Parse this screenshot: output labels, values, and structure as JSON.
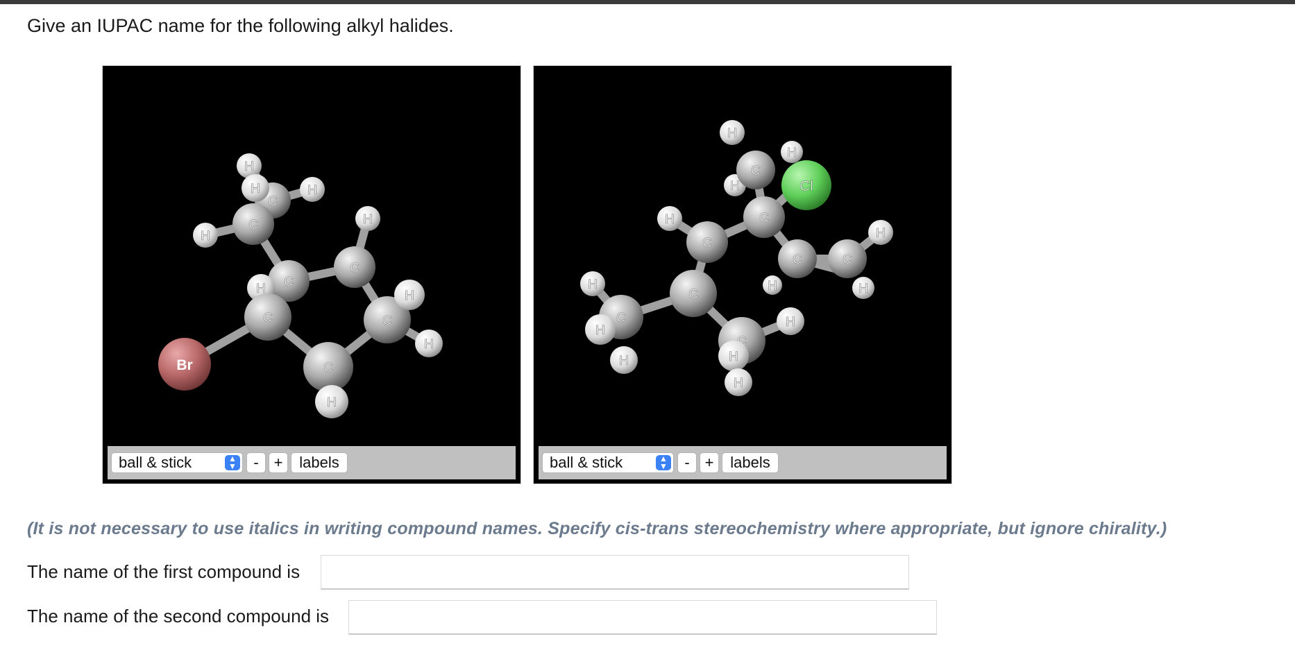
{
  "prompt": "Give an IUPAC name for the following alkyl halides.",
  "viewers": [
    {
      "style_select": "ball & stick",
      "minus_label": "-",
      "plus_label": "+",
      "labels_button": "labels",
      "atom_labels": {
        "carbon": "C",
        "hydrogen": "H",
        "halogen": "Br"
      },
      "colors": {
        "halogen": "#c77676",
        "carbon": "#a8a8a8",
        "hydrogen": "#e6e6e6"
      }
    },
    {
      "style_select": "ball & stick",
      "minus_label": "-",
      "plus_label": "+",
      "labels_button": "labels",
      "atom_labels": {
        "carbon": "C",
        "hydrogen": "H",
        "halogen": "Cl"
      },
      "colors": {
        "halogen": "#66d266",
        "carbon": "#a8a8a8",
        "hydrogen": "#e6e6e6"
      }
    }
  ],
  "note": "(It is not necessary to use italics in writing compound names. Specify cis-trans stereochemistry where appropriate, but ignore chirality.)",
  "answers": [
    {
      "label": "The name of the first compound is",
      "value": ""
    },
    {
      "label": "The name of the second compound is",
      "value": ""
    }
  ],
  "icons": {
    "select_arrow": "chevron-up-down-icon"
  }
}
